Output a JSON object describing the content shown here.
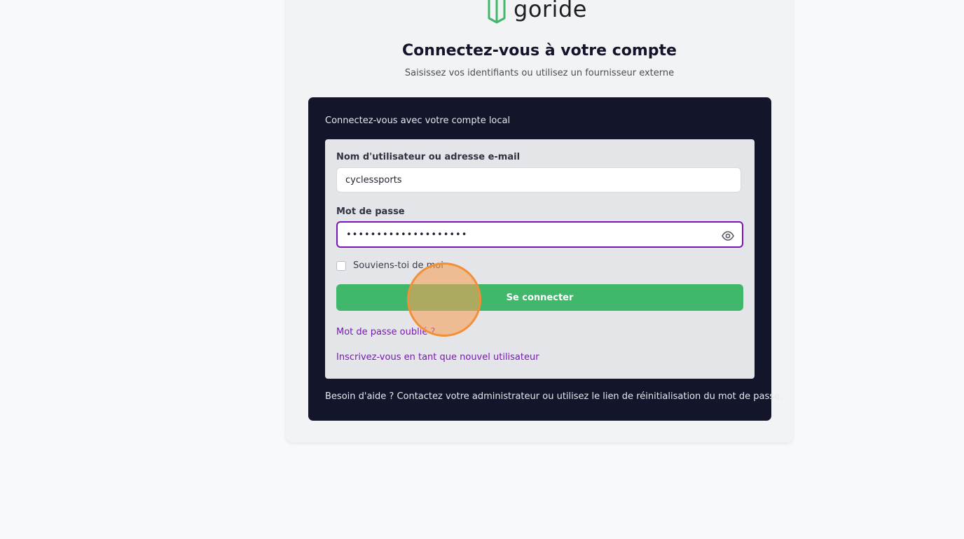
{
  "brand": {
    "name": "goride",
    "logo_color": "#41b76b",
    "logo_icon": "book-open-icon"
  },
  "header": {
    "title": "Connectez-vous à votre compte",
    "subtitle": "Saisissez vos identifiants ou utilisez un fournisseur externe"
  },
  "login_panel": {
    "heading": "Connectez-vous avec votre compte local",
    "username": {
      "label": "Nom d'utilisateur ou adresse e-mail",
      "value": "cyclessports"
    },
    "password": {
      "label": "Mot de passe",
      "value": "••••••••••••••••••••",
      "toggle_icon": "eye-icon"
    },
    "remember_me": {
      "label": "Souviens-toi de moi",
      "checked": false
    },
    "submit_label": "Se connecter",
    "forgot_password_link": "Mot de passe oublié ?",
    "register_link": "Inscrivez-vous en tant que nouvel utilisateur",
    "help_text": "Besoin d'aide ? Contactez votre administrateur ou utilisez le lien de réinitialisation du mot de passe."
  },
  "colors": {
    "accent": "#7a16b8",
    "primary_button": "#41b76b",
    "panel_background": "#13152a"
  }
}
